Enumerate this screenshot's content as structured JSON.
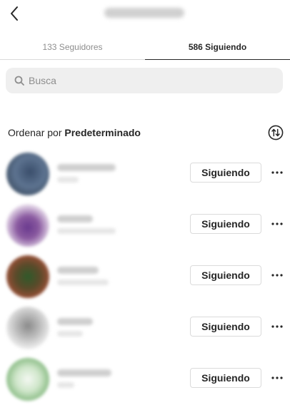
{
  "header": {
    "back_icon": "chevron-left-icon"
  },
  "tabs": [
    {
      "label": "133 Seguidores",
      "active": false
    },
    {
      "label": "586 Siguiendo",
      "active": true
    }
  ],
  "search": {
    "placeholder": "Busca",
    "value": "",
    "icon": "search-icon"
  },
  "sort": {
    "prefix": "Ordenar por ",
    "value": "Predeterminado",
    "toggle_icon": "sort-arrows-icon"
  },
  "following": [
    {
      "button_label": "Siguiendo",
      "more_icon": "more-horizontal-icon",
      "avatar_color": "#3a4e6b"
    },
    {
      "button_label": "Siguiendo",
      "more_icon": "more-horizontal-icon",
      "avatar_color": "#6a3a8e"
    },
    {
      "button_label": "Siguiendo",
      "more_icon": "more-horizontal-icon",
      "avatar_color": "#5a4a2a"
    },
    {
      "button_label": "Siguiendo",
      "more_icon": "more-horizontal-icon",
      "avatar_color": "#9a9a9a"
    },
    {
      "button_label": "Siguiendo",
      "more_icon": "more-horizontal-icon",
      "avatar_color": "#8fbf8a"
    }
  ],
  "colors": {
    "text": "#262626",
    "muted": "#8e8e8e",
    "border": "#dbdbdb",
    "search_bg": "#efefef"
  }
}
